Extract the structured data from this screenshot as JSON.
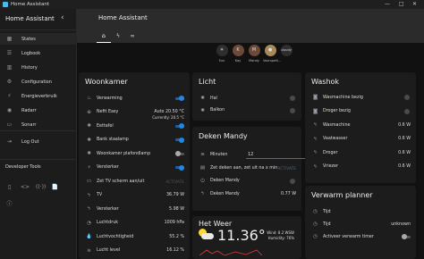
{
  "window": {
    "title": "Home Assistant",
    "controls": [
      "—",
      "□",
      "✕"
    ]
  },
  "sidebar": {
    "title": "Home Assistant",
    "items": [
      {
        "label": "States",
        "icon": "grid-icon",
        "glyph": "▦",
        "active": true
      },
      {
        "label": "Logbook",
        "icon": "logbook-icon",
        "glyph": "☰"
      },
      {
        "label": "History",
        "icon": "history-icon",
        "glyph": "▥"
      },
      {
        "label": "Configuration",
        "icon": "gear-icon",
        "glyph": "⚙"
      },
      {
        "label": "Energieverbruik",
        "icon": "energy-icon",
        "glyph": "⚡"
      },
      {
        "label": "Radarr",
        "icon": "radar-icon",
        "glyph": "◉"
      },
      {
        "label": "Sonarr",
        "icon": "tv-icon",
        "glyph": "▭"
      },
      {
        "label": "Log Out",
        "icon": "logout-icon",
        "glyph": "⇥"
      }
    ],
    "developer_tools_label": "Developer Tools",
    "dev_icons": [
      {
        "name": "remote-icon",
        "glyph": "▯"
      },
      {
        "name": "code-icon",
        "glyph": "<>"
      },
      {
        "name": "broadcast-icon",
        "glyph": "((·))"
      },
      {
        "name": "template-icon",
        "glyph": "📄"
      },
      {
        "name": "info-icon",
        "glyph": "ⓘ"
      }
    ]
  },
  "header": {
    "title": "Home Assistant",
    "tabs": [
      {
        "name": "tab-home",
        "glyph": "⌂",
        "selected": true
      },
      {
        "name": "tab-energy",
        "glyph": "ϟ"
      },
      {
        "name": "tab-glasses",
        "glyph": "∞"
      }
    ]
  },
  "badges": [
    {
      "label": "Sun",
      "glyph": "☀"
    },
    {
      "label": "Kay",
      "glyph": "K"
    },
    {
      "label": "Mandy",
      "glyph": "M"
    },
    {
      "label": "Voorspelli...",
      "glyph": "●"
    },
    {
      "label": "",
      "glyph": "cloudy"
    }
  ],
  "cards": {
    "woonkamer": {
      "title": "Woonkamer",
      "rows": [
        {
          "label": "Verwarming",
          "icon": "heater-icon",
          "glyph": "♨",
          "toggle": "on"
        },
        {
          "label": "Nefit Easy",
          "icon": "thermostat-icon",
          "glyph": "⊕",
          "state": "Auto 20.50 °C",
          "substate": "Currently: 20.5 °C"
        },
        {
          "label": "Eettafel",
          "icon": "bulb-icon",
          "glyph": "✺",
          "toggle": "on"
        },
        {
          "label": "Bank staalamp",
          "icon": "bulb-icon",
          "glyph": "✺",
          "toggle": "on"
        },
        {
          "label": "Woonkamer plafondlamp",
          "icon": "bulb-icon",
          "glyph": "✺",
          "toggle": "off"
        },
        {
          "label": "Versterker",
          "icon": "amplifier-icon",
          "glyph": "⚡",
          "toggle": "on"
        },
        {
          "label": "Zet TV scherm aan/uit",
          "icon": "tv-icon",
          "glyph": "▭",
          "action": "ACTIVATE"
        },
        {
          "label": "TV",
          "icon": "flash-icon",
          "glyph": "ϟ",
          "state": "36.79 W"
        },
        {
          "label": "Versterker",
          "icon": "flash-icon",
          "glyph": "ϟ",
          "state": "5.98 W"
        },
        {
          "label": "Luchtdruk",
          "icon": "gauge-icon",
          "glyph": "◔",
          "state": "1009 hPa"
        },
        {
          "label": "Luchtvochtigheid",
          "icon": "humidity-icon",
          "glyph": "💧",
          "state": "55.2 %"
        },
        {
          "label": "Lucht level",
          "icon": "air-icon",
          "glyph": "≋",
          "state": "16.12 %"
        }
      ]
    },
    "licht": {
      "title": "Licht",
      "rows": [
        {
          "label": "Hal",
          "icon": "bulb-icon",
          "glyph": "✺",
          "dot": true
        },
        {
          "label": "Balkon",
          "icon": "bulb-icon",
          "glyph": "✺",
          "dot": true
        }
      ]
    },
    "deken": {
      "title": "Deken Mandy",
      "minutes_label": "Minuten",
      "minutes_value": "12",
      "rows": [
        {
          "label": "Zet deken aan, zet uit na x min",
          "icon": "script-icon",
          "glyph": "▤",
          "action": "ACTIVATE"
        },
        {
          "label": "Deken Mandy",
          "icon": "power-icon",
          "glyph": "⏻",
          "dot": true
        },
        {
          "label": "Deken Mandy",
          "icon": "flash-icon",
          "glyph": "ϟ",
          "state": "0.77 W"
        }
      ]
    },
    "weer": {
      "title": "Het Weer",
      "temp": "11.36°",
      "wind": "Wind: 8.2 WSW",
      "humidity": "Humidity: 76%"
    },
    "washok": {
      "title": "Washok",
      "rows": [
        {
          "label": "Wasmachine bezig",
          "icon": "washer-icon",
          "glyph": "◙",
          "dot": true
        },
        {
          "label": "Droger bezig",
          "icon": "dryer-icon",
          "glyph": "◙",
          "dot": true
        },
        {
          "label": "Wasmachine",
          "icon": "flash-icon",
          "glyph": "ϟ",
          "state": "0.6 W"
        },
        {
          "label": "Vaatwasser",
          "icon": "flash-icon",
          "glyph": "ϟ",
          "state": "0.6 W"
        },
        {
          "label": "Droger",
          "icon": "flash-icon",
          "glyph": "ϟ",
          "state": "0.6 W"
        },
        {
          "label": "Vriezer",
          "icon": "flash-icon",
          "glyph": "ϟ",
          "state": "0.6 W"
        }
      ]
    },
    "verwarm": {
      "title": "Verwarm planner",
      "rows": [
        {
          "label": "Tijd",
          "icon": "clock-icon",
          "glyph": "◷",
          "state": ""
        },
        {
          "label": "Tijd",
          "icon": "clock-icon",
          "glyph": "◷",
          "state": "unknown"
        },
        {
          "label": "Activeer verwarm timer",
          "icon": "timer-icon",
          "glyph": "◷",
          "toggle": "off"
        }
      ]
    }
  }
}
